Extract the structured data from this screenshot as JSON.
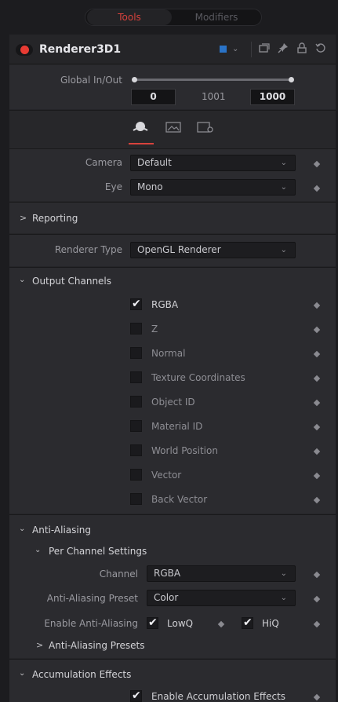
{
  "tabs": {
    "tools": "Tools",
    "modifiers": "Modifiers"
  },
  "node": {
    "name": "Renderer3D1",
    "color": "#2a73c7"
  },
  "global_inout": {
    "label": "Global In/Out",
    "start": "0",
    "mid": "1001",
    "end": "1000"
  },
  "controls": {
    "camera_label": "Camera",
    "camera_value": "Default",
    "eye_label": "Eye",
    "eye_value": "Mono"
  },
  "reporting": {
    "label": "Reporting"
  },
  "renderer": {
    "label": "Renderer Type",
    "value": "OpenGL Renderer"
  },
  "output_channels": {
    "label": "Output Channels",
    "items": [
      {
        "label": "RGBA",
        "checked": true
      },
      {
        "label": "Z",
        "checked": false
      },
      {
        "label": "Normal",
        "checked": false
      },
      {
        "label": "Texture Coordinates",
        "checked": false
      },
      {
        "label": "Object ID",
        "checked": false
      },
      {
        "label": "Material ID",
        "checked": false
      },
      {
        "label": "World Position",
        "checked": false
      },
      {
        "label": "Vector",
        "checked": false
      },
      {
        "label": "Back Vector",
        "checked": false
      }
    ]
  },
  "anti_aliasing": {
    "label": "Anti-Aliasing",
    "per_channel": "Per Channel Settings",
    "channel_label": "Channel",
    "channel_value": "RGBA",
    "preset_label": "Anti-Aliasing Preset",
    "preset_value": "Color",
    "enable_label": "Enable Anti-Aliasing",
    "lowq": "LowQ",
    "hiq": "HiQ",
    "presets": "Anti-Aliasing Presets"
  },
  "accumulation": {
    "label": "Accumulation Effects",
    "enable": "Enable Accumulation Effects"
  },
  "colors": {
    "accent": "#d8423c",
    "panel": "#2b2b2f"
  }
}
